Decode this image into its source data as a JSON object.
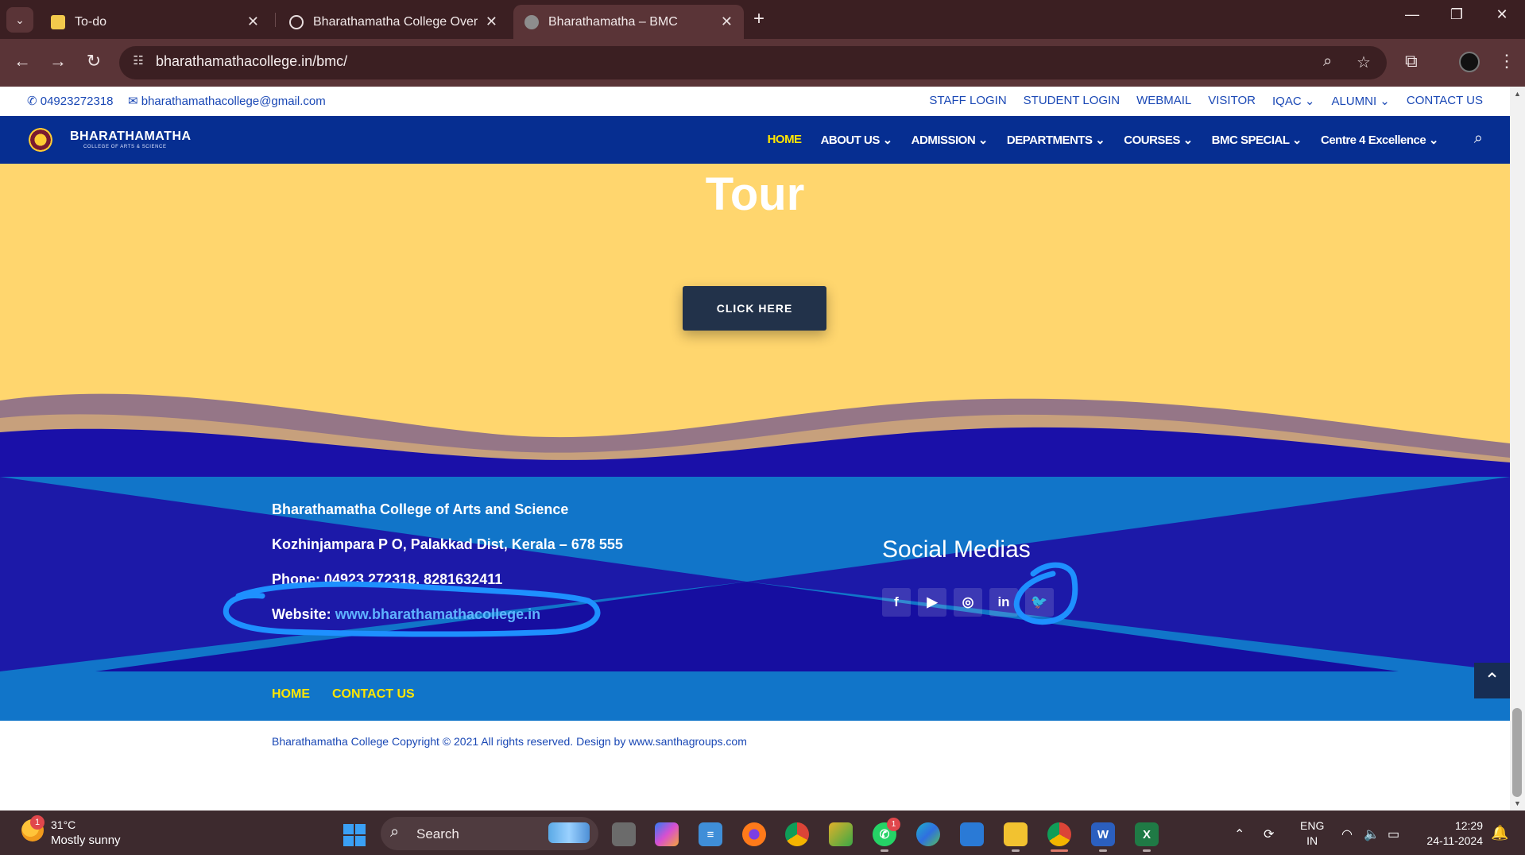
{
  "browser": {
    "tabs": [
      {
        "title": "To-do",
        "icon": "todo-icon"
      },
      {
        "title": "Bharathamatha College Overvie",
        "icon": "chatgpt-icon"
      },
      {
        "title": "Bharathamatha – BMC",
        "icon": "globe-icon",
        "active": true
      }
    ],
    "url": "bharathamathacollege.in/bmc/"
  },
  "site": {
    "topbar": {
      "phone": "04923272318",
      "email": "bharathamathacollege@gmail.com",
      "links": [
        "STAFF LOGIN",
        "STUDENT LOGIN",
        "WEBMAIL",
        "VISITOR",
        "IQAC",
        "ALUMNI",
        "CONTACT US"
      ]
    },
    "logo": {
      "name": "BHARATHAMATHA",
      "subtitle": "COLLEGE OF ARTS & SCIENCE"
    },
    "nav": [
      "HOME",
      "ABOUT US",
      "ADMISSION",
      "DEPARTMENTS",
      "COURSES",
      "BMC SPECIAL",
      "Centre 4 Excellence"
    ],
    "hero": {
      "title": "Tour",
      "button": "CLICK HERE"
    },
    "footer": {
      "college": "Bharathamatha College of Arts and Science",
      "address": "Kozhinjampara P O, Palakkad Dist, Kerala – 678 555",
      "phone": "Phone: 04923 272318, 8281632411",
      "website_label": "Website: ",
      "website_url": "www.bharathamathacollege.in",
      "social_title": "Social Medias",
      "social": [
        "facebook-icon",
        "youtube-icon",
        "instagram-icon",
        "linkedin-icon",
        "twitter-icon"
      ],
      "bottom_links": [
        "HOME",
        "CONTACT US"
      ],
      "copyright": "Bharathamatha College Copyright © 2021 All rights reserved. Design by www.santhagroups.com"
    }
  },
  "taskbar": {
    "weather": {
      "temp": "31°C",
      "desc": "Mostly sunny",
      "badge": "1"
    },
    "search": "Search",
    "whatsapp_badge": "1",
    "lang": [
      "ENG",
      "IN"
    ],
    "time": "12:29",
    "date": "24-11-2024"
  },
  "colors": {
    "nav": "#062e91",
    "hero": "#ffd66e",
    "footer": "#1175c9",
    "accent": "#ffe600",
    "annotation": "#1e90ff"
  }
}
